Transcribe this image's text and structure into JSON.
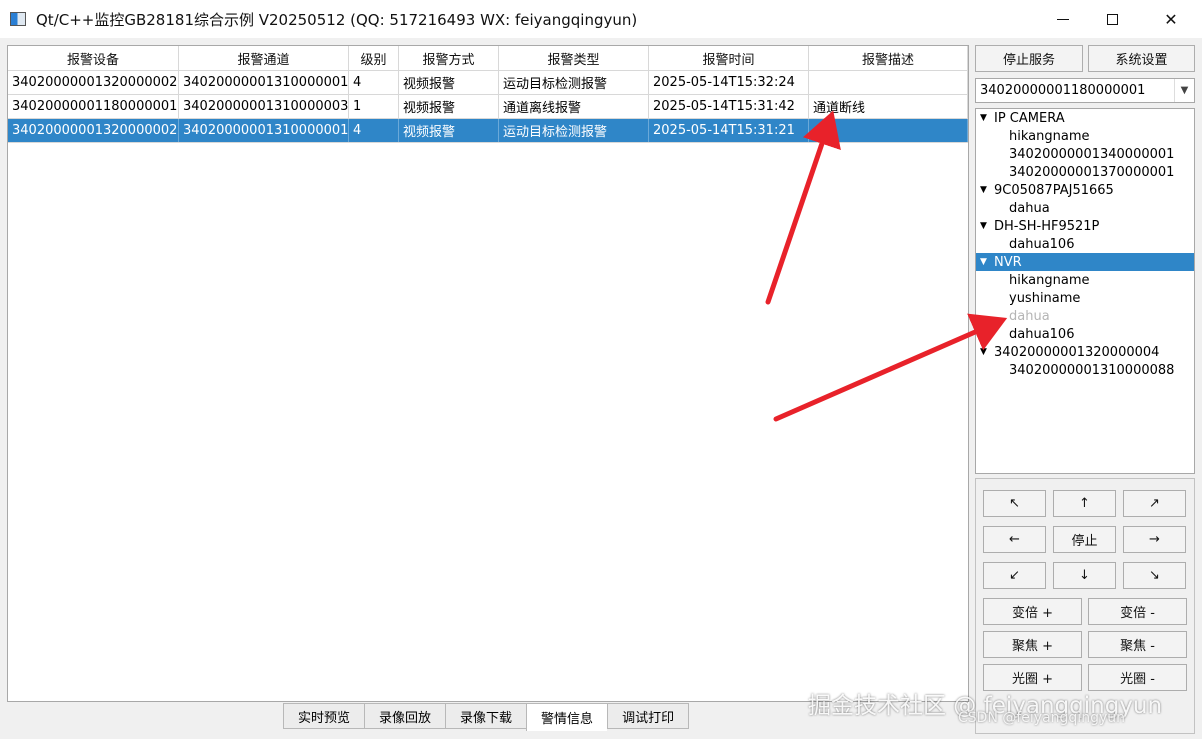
{
  "window": {
    "title": "Qt/C++监控GB28181综合示例 V20250512 (QQ: 517216493 WX: feiyangqingyun)",
    "min_icon": "minimize-icon",
    "max_icon": "maximize-icon",
    "close_glyph": "✕"
  },
  "alarm_table": {
    "headers": [
      "报警设备",
      "报警通道",
      "级别",
      "报警方式",
      "报警类型",
      "报警时间",
      "报警描述"
    ],
    "rows": [
      [
        "34020000001320000002",
        "34020000001310000001",
        "4",
        "视频报警",
        "运动目标检测报警",
        "2025-05-14T15:32:24",
        ""
      ],
      [
        "34020000001180000001",
        "34020000001310000003",
        "1",
        "视频报警",
        "通道离线报警",
        "2025-05-14T15:31:42",
        "通道断线"
      ],
      [
        "34020000001320000002",
        "34020000001310000001",
        "4",
        "视频报警",
        "运动目标检测报警",
        "2025-05-14T15:31:21",
        ""
      ]
    ],
    "selected_row": 2
  },
  "tabs": [
    {
      "label": "实时预览",
      "active": false
    },
    {
      "label": "录像回放",
      "active": false
    },
    {
      "label": "录像下载",
      "active": false
    },
    {
      "label": "警情信息",
      "active": true
    },
    {
      "label": "调试打印",
      "active": false
    }
  ],
  "top_buttons": {
    "stop_service": "停止服务",
    "settings": "系统设置"
  },
  "device_combo": {
    "value": "34020000001180000001",
    "arrow_glyph": "▼"
  },
  "tree": {
    "expand_glyph": "▼",
    "groups": [
      {
        "label": "IP CAMERA",
        "children": [
          "hikangname",
          "34020000001340000001",
          "34020000001370000001"
        ]
      },
      {
        "label": "9C05087PAJ51665",
        "children": [
          "dahua"
        ]
      },
      {
        "label": "DH-SH-HF9521P",
        "children": [
          "dahua106"
        ]
      },
      {
        "label": "NVR",
        "selected": true,
        "children": [
          "hikangname",
          "yushiname",
          "dahua",
          "dahua106"
        ],
        "disabled_child": 2
      },
      {
        "label": "34020000001320000004",
        "children": [
          "34020000001310000088"
        ]
      }
    ]
  },
  "ptz": {
    "up_left": "↖",
    "up": "↑",
    "up_right": "↗",
    "left": "←",
    "stop": "停止",
    "right": "→",
    "down_left": "↙",
    "down": "↓",
    "down_right": "↘",
    "zoom_in": "变倍 +",
    "zoom_out": "变倍 -",
    "focus_in": "聚焦 +",
    "focus_out": "聚焦 -",
    "iris_in": "光圈 +",
    "iris_out": "光圈 -"
  },
  "watermark": {
    "main": "掘金技术社区 @ feiyangqingyun",
    "sub": "CSDN @feiyangqingyun"
  },
  "annotation_color": "#e8222a",
  "selection_color": "#2f86c8"
}
